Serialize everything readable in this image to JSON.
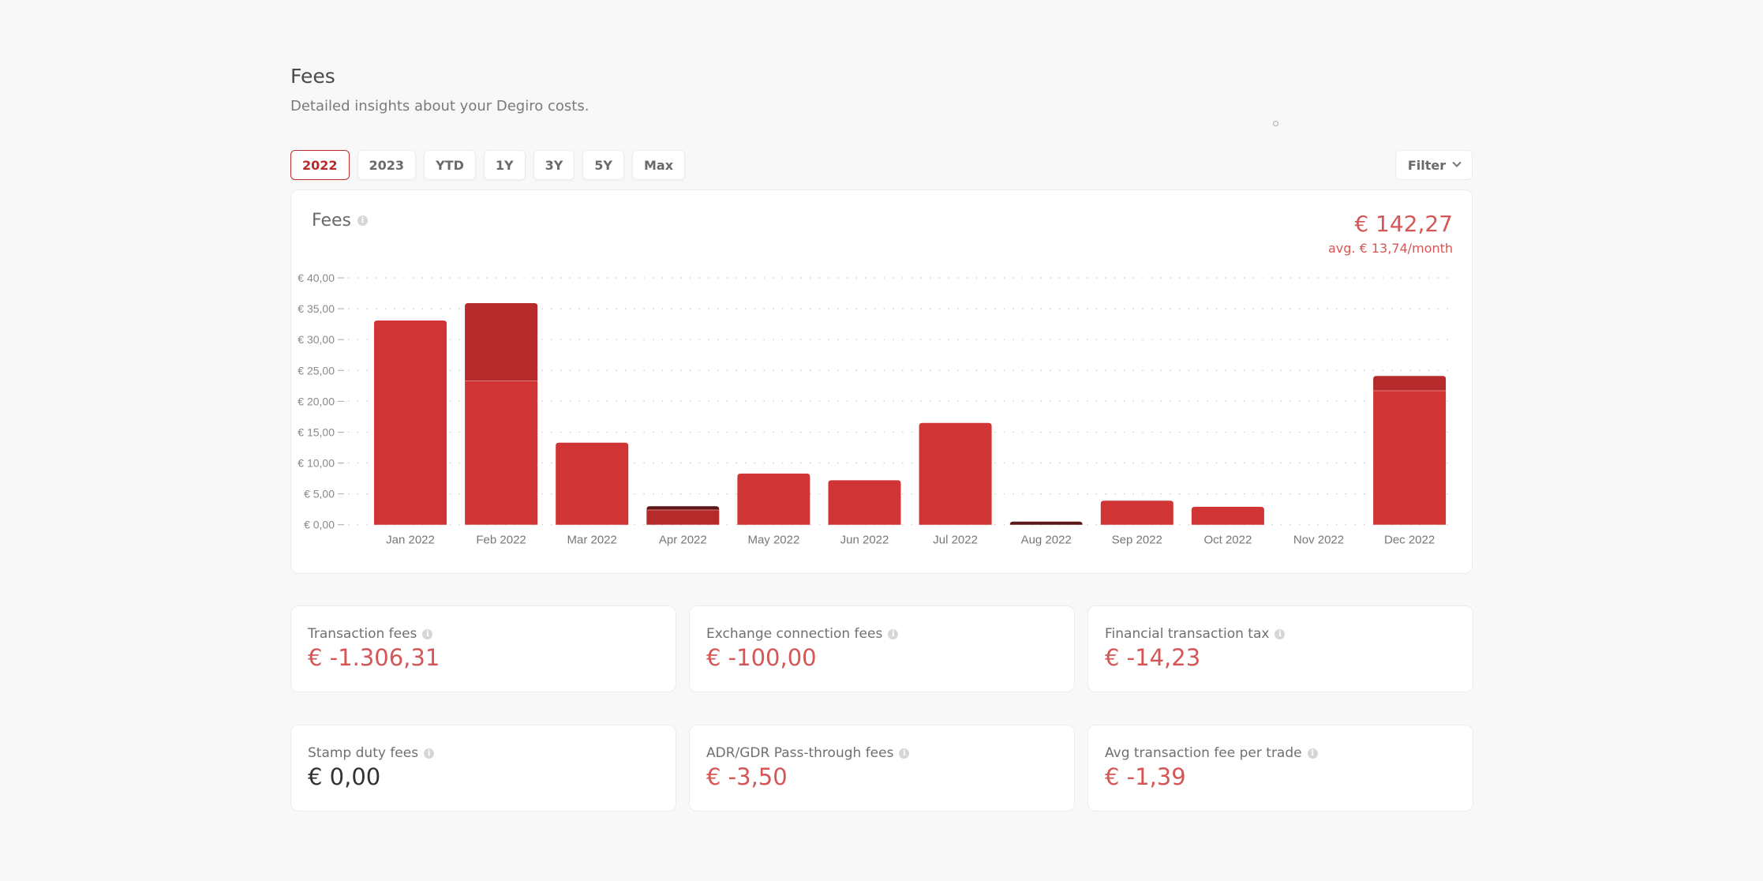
{
  "header": {
    "title": "Fees",
    "subtitle": "Detailed insights about your Degiro costs."
  },
  "period_tabs": [
    {
      "label": "2022",
      "active": true
    },
    {
      "label": "2023",
      "active": false
    },
    {
      "label": "YTD",
      "active": false
    },
    {
      "label": "1Y",
      "active": false
    },
    {
      "label": "3Y",
      "active": false
    },
    {
      "label": "5Y",
      "active": false
    },
    {
      "label": "Max",
      "active": false
    }
  ],
  "filter": {
    "label": "Filter",
    "icon": "chevron-down-icon"
  },
  "chart_card": {
    "title": "Fees",
    "info_icon": "i",
    "total": "€ 142,27",
    "average": "avg. € 13,74/month"
  },
  "colors": {
    "accent": "#b52a2a",
    "negative_value": "#d55656",
    "series_primary": "#d03434",
    "series_secondary": "#b52a2a",
    "series_tertiary": "#5c1818"
  },
  "chart_data": {
    "type": "bar",
    "stacked": true,
    "title": "Fees",
    "xlabel": "",
    "ylabel": "",
    "ylim": [
      0,
      40
    ],
    "grid": true,
    "yticks": [
      0,
      5,
      10,
      15,
      20,
      25,
      30,
      35,
      40
    ],
    "ytick_labels": [
      "€ 0,00",
      "€ 5,00",
      "€ 10,00",
      "€ 15,00",
      "€ 20,00",
      "€ 25,00",
      "€ 30,00",
      "€ 35,00",
      "€ 40,00"
    ],
    "categories": [
      "Jan 2022",
      "Feb 2022",
      "Mar 2022",
      "Apr 2022",
      "May 2022",
      "Jun 2022",
      "Jul 2022",
      "Aug 2022",
      "Sep 2022",
      "Oct 2022",
      "Nov 2022",
      "Dec 2022"
    ],
    "series": [
      {
        "name": "primary",
        "color": "#d03434",
        "values": [
          33.1,
          23.3,
          13.3,
          0,
          8.3,
          7.2,
          16.5,
          0,
          3.9,
          2.9,
          0,
          21.7
        ]
      },
      {
        "name": "secondary",
        "color": "#b52a2a",
        "values": [
          0,
          12.6,
          0,
          2.4,
          0,
          0,
          0,
          0,
          0,
          0,
          0,
          2.4
        ]
      },
      {
        "name": "tertiary",
        "color": "#5c1818",
        "values": [
          0,
          0,
          0,
          0.6,
          0,
          0,
          0,
          0.5,
          0,
          0,
          0,
          0
        ]
      }
    ],
    "legend": "none"
  },
  "stats": [
    {
      "label": "Transaction fees",
      "value": "€ -1.306,31",
      "negative": true
    },
    {
      "label": "Exchange connection fees",
      "value": "€ -100,00",
      "negative": true
    },
    {
      "label": "Financial transaction tax",
      "value": "€ -14,23",
      "negative": true
    },
    {
      "label": "Stamp duty fees",
      "value": "€ 0,00",
      "negative": false
    },
    {
      "label": "ADR/GDR Pass-through fees",
      "value": "€ -3,50",
      "negative": true
    },
    {
      "label": "Avg transaction fee per trade",
      "value": "€ -1,39",
      "negative": true
    }
  ]
}
